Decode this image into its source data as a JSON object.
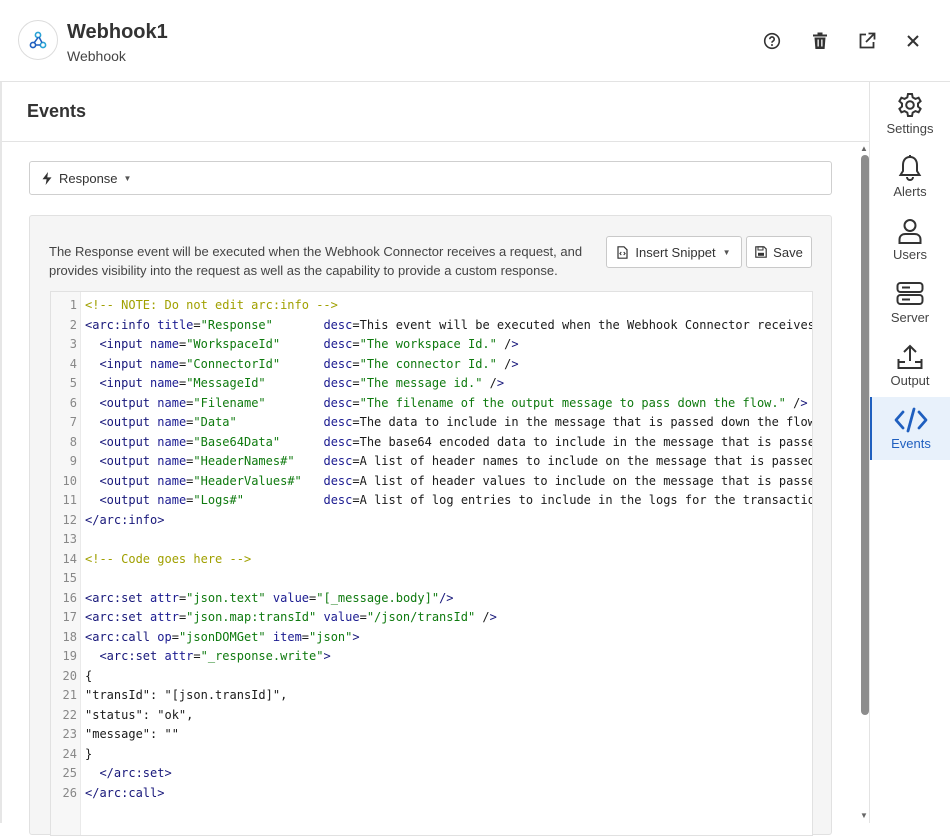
{
  "app": {
    "title": "Webhook1",
    "subtitle": "Webhook",
    "icon": "webhook-icon"
  },
  "header_actions": [
    {
      "name": "help-icon",
      "label": "help"
    },
    {
      "name": "trash-icon",
      "label": "delete"
    },
    {
      "name": "external-link-icon",
      "label": "open in new window"
    },
    {
      "name": "close-icon",
      "label": "close"
    }
  ],
  "section": {
    "title": "Events"
  },
  "event_select": {
    "value": "Response",
    "icon": "bolt-icon"
  },
  "panel": {
    "description": "The Response event will be executed when the Webhook Connector receives a request, and provides visibility into the request as well as the capability to provide a custom response.",
    "insert_snippet_label": "Insert Snippet",
    "save_label": "Save"
  },
  "code_lines": [
    {
      "n": "1",
      "text": "<!-- NOTE: Do not edit arc:info -->"
    },
    {
      "n": "2",
      "text": "<arc:info title=\"Response\"       desc=\"This event will be executed when the Webhook Connector receives"
    },
    {
      "n": "3",
      "text": "  <input name=\"WorkspaceId\"      desc=\"The workspace Id.\" />"
    },
    {
      "n": "4",
      "text": "  <input name=\"ConnectorId\"      desc=\"The connector Id.\" />"
    },
    {
      "n": "5",
      "text": "  <input name=\"MessageId\"        desc=\"The message id.\" />"
    },
    {
      "n": "6",
      "text": "  <output name=\"Filename\"        desc=\"The filename of the output message to pass down the flow.\" />"
    },
    {
      "n": "7",
      "text": "  <output name=\"Data\"            desc=\"The data to include in the message that is passed down the flow"
    },
    {
      "n": "8",
      "text": "  <output name=\"Base64Data\"      desc=\"The base64 encoded data to include in the message that is passe"
    },
    {
      "n": "9",
      "text": "  <output name=\"HeaderNames#\"    desc=\"A list of header names to include on the message that is passed"
    },
    {
      "n": "10",
      "text": "  <output name=\"HeaderValues#\"   desc=\"A list of header values to include on the message that is passe"
    },
    {
      "n": "11",
      "text": "  <output name=\"Logs#\"           desc=\"A list of log entries to include in the logs for the transactio"
    },
    {
      "n": "12",
      "text": "</arc:info>"
    },
    {
      "n": "13",
      "text": ""
    },
    {
      "n": "14",
      "text": "<!-- Code goes here -->"
    },
    {
      "n": "15",
      "text": ""
    },
    {
      "n": "16",
      "text": "<arc:set attr=\"json.text\" value=\"[_message.body]\"/>"
    },
    {
      "n": "17",
      "text": "<arc:set attr=\"json.map:transId\" value=\"/json/transId\" />"
    },
    {
      "n": "18",
      "text": "<arc:call op=\"jsonDOMGet\" item=\"json\">"
    },
    {
      "n": "19",
      "text": "  <arc:set attr=\"_response.write\">"
    },
    {
      "n": "20",
      "text": "{"
    },
    {
      "n": "21",
      "text": "\"transId\": \"[json.transId]\","
    },
    {
      "n": "22",
      "text": "\"status\": \"ok\","
    },
    {
      "n": "23",
      "text": "\"message\": \"\""
    },
    {
      "n": "24",
      "text": "}"
    },
    {
      "n": "25",
      "text": "  </arc:set>"
    },
    {
      "n": "26",
      "text": "</arc:call>"
    }
  ],
  "rail": [
    {
      "key": "settings",
      "label": "Settings",
      "icon": "gear-icon",
      "active": false
    },
    {
      "key": "alerts",
      "label": "Alerts",
      "icon": "bell-icon",
      "active": false
    },
    {
      "key": "users",
      "label": "Users",
      "icon": "user-icon",
      "active": false
    },
    {
      "key": "server",
      "label": "Server",
      "icon": "server-icon",
      "active": false
    },
    {
      "key": "output",
      "label": "Output",
      "icon": "upload-icon",
      "active": false
    },
    {
      "key": "events",
      "label": "Events",
      "icon": "code-icon",
      "active": true
    }
  ],
  "colors": {
    "accent": "#1f5fbf",
    "active_bg": "#e8f1fb",
    "code_comment": "#a0a000",
    "code_string": "#0f7a0f",
    "code_tag": "#17177a"
  }
}
